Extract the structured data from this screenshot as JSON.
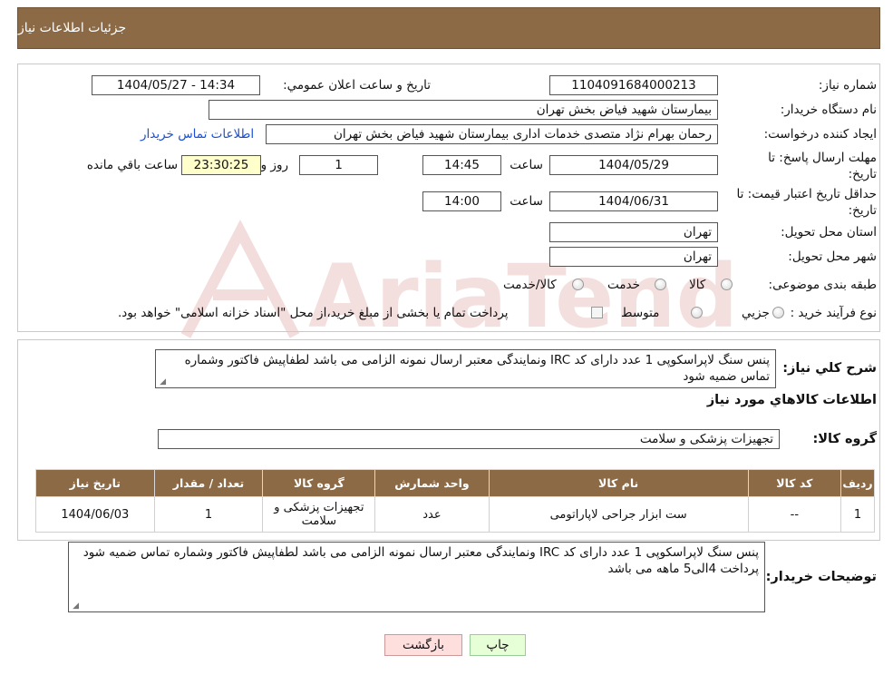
{
  "header": {
    "title": "جزئيات اطلاعات نياز"
  },
  "form": {
    "need_number_label": "شماره نياز:",
    "need_number": "1104091684000213",
    "announce_label": "تاريخ و ساعت اعلان عمومي:",
    "announce_value": "1404/05/27 - 14:34",
    "buyer_org_label": "نام دستگاه خريدار:",
    "buyer_org": "بیمارستان شهید فیاض بخش تهران",
    "requester_label": "ايجاد کننده درخواست:",
    "requester": "رحمان بهرام نژاد متصدی خدمات اداری بیمارستان شهید فیاض بخش تهران",
    "contact_link": "اطلاعات تماس خريدار",
    "deadline_label_1": "مهلت ارسال پاسخ: تا",
    "deadline_label_2": "تاريخ:",
    "deadline_date": "1404/05/29",
    "time_label": "ساعت",
    "deadline_time": "14:45",
    "days_value": "1",
    "days_label": "روز و",
    "remaining_time": "23:30:25",
    "remaining_label": "ساعت باقي مانده",
    "validity_label_1": "حداقل تاريخ اعتبار قيمت: تا",
    "validity_label_2": "تاريخ:",
    "validity_date": "1404/06/31",
    "validity_time": "14:00",
    "province_label": "استان محل تحويل:",
    "province": "تهران",
    "city_label": "شهر محل تحويل:",
    "city": "تهران",
    "category_label": "طبقه بندی موضوعی:",
    "category_options": [
      "کالا",
      "خدمت",
      "کالا/خدمت"
    ],
    "process_label": "نوع فرآيند خريد :",
    "process_options": [
      "جزيي",
      "متوسط"
    ],
    "process_note": "پرداخت تمام يا بخشی از مبلغ خريد،از محل \"اسناد خزانه اسلامی\" خواهد بود."
  },
  "description": {
    "label": "شرح کلي نياز:",
    "text": "پنس سنگ لاپراسکوپی 1 عدد دارای کد IRC ونمایندگی معتبر ارسال نمونه الزامی می باشد لطفاپیش فاکتور وشماره تماس ضمیه شود"
  },
  "goods": {
    "section_title": "اطلاعات کالاهاي مورد نياز",
    "group_label": "گروه کالا:",
    "group_value": "تجهیزات پزشکی و سلامت",
    "columns": [
      "رديف",
      "کد کالا",
      "نام کالا",
      "واحد شمارش",
      "گروه کالا",
      "تعداد / مقدار",
      "تاريخ نياز"
    ],
    "rows": [
      [
        "1",
        "--",
        "ست ابزار جراحی لاپاراتومی",
        "عدد",
        "تجهیزات پزشکی و سلامت",
        "1",
        "1404/06/03"
      ]
    ]
  },
  "buyer_notes": {
    "label": "توضيحات خريدار:",
    "text": "پنس سنگ لاپراسکوپی 1 عدد دارای کد IRC ونمایندگی معتبر ارسال نمونه الزامی می باشد لطفاپیش فاکتور وشماره تماس ضمیه شود پرداخت 4الی5 ماهه می باشد"
  },
  "buttons": {
    "print": "چاپ",
    "back": "بازگشت"
  },
  "watermark": {
    "text": "AriaTender.neT"
  },
  "colors": {
    "header_bg": "#8b6a45",
    "watermark": "#e7b9b9"
  }
}
